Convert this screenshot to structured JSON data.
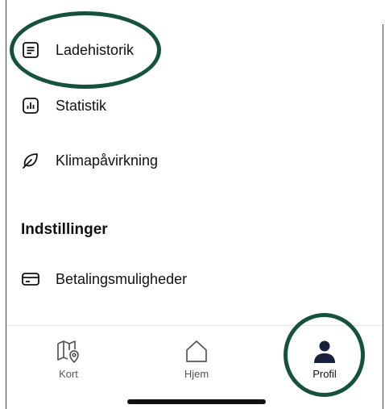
{
  "menu": {
    "items": [
      {
        "label": "Ladehistorik",
        "icon": "document-list-icon"
      },
      {
        "label": "Statistik",
        "icon": "bar-chart-icon"
      },
      {
        "label": "Klimapåvirkning",
        "icon": "leaf-icon"
      }
    ]
  },
  "settings": {
    "title": "Indstillinger",
    "items": [
      {
        "label": "Betalingsmuligheder",
        "icon": "credit-card-icon"
      }
    ]
  },
  "tabbar": {
    "tabs": [
      {
        "label": "Kort",
        "icon": "map-pin-icon"
      },
      {
        "label": "Hjem",
        "icon": "home-icon"
      },
      {
        "label": "Profil",
        "icon": "person-icon",
        "active": true
      }
    ]
  },
  "colors": {
    "highlight_ring": "#15523e",
    "text": "#111111",
    "tab_inactive": "#555555",
    "active_icon": "#16213e"
  }
}
